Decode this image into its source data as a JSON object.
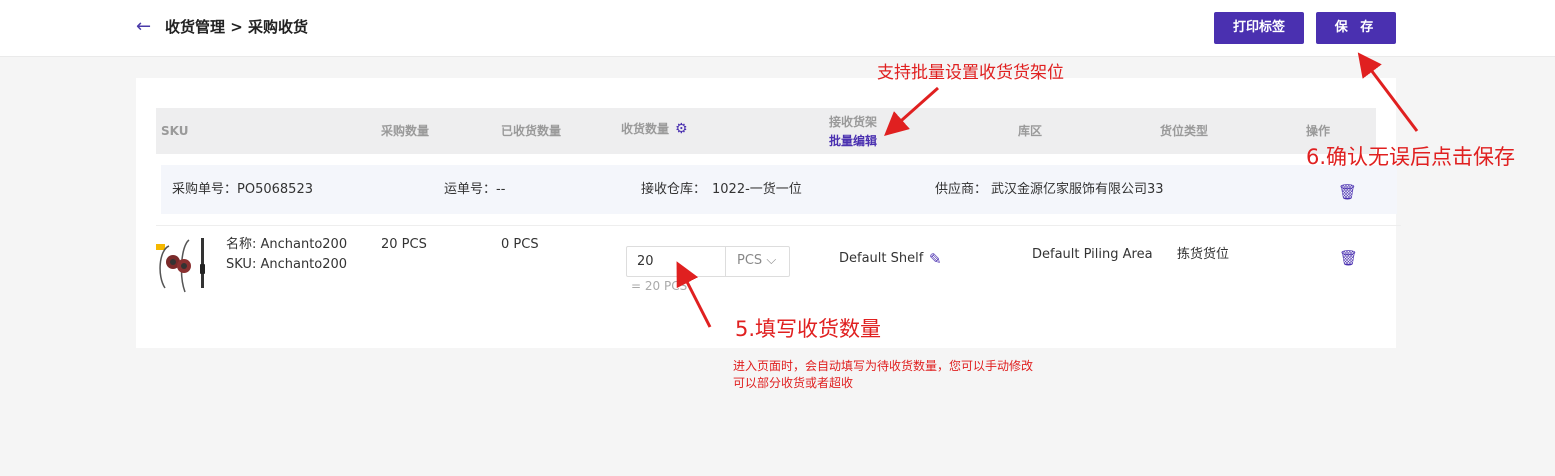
{
  "header": {
    "breadcrumb": "收货管理 > 采购收货",
    "print_label": "打印标签",
    "save_label": "保 存"
  },
  "table": {
    "columns": {
      "sku": "SKU",
      "purchase_qty": "采购数量",
      "received_qty": "已收货数量",
      "receiving_qty": "收货数量",
      "shelf": "接收货架",
      "batch_edit": "批量编辑",
      "zone": "库区",
      "slot_type": "货位类型",
      "actions": "操作"
    },
    "group": {
      "po_label": "采购单号：",
      "po_value": "PO5068523",
      "waybill_label": "运单号：",
      "waybill_value": "--",
      "warehouse_label": "接收仓库：",
      "warehouse_value": "1022-一货一位",
      "supplier_label": "供应商：",
      "supplier_value": "武汉金源亿家服饰有限公司33"
    },
    "row": {
      "name": "名称: Anchanto200",
      "sku": "SKU: Anchanto200",
      "purchase_qty": "20 PCS",
      "received_qty": "0 PCS",
      "receiving_qty": "20",
      "unit": "PCS",
      "equals": "= 20 PCS",
      "shelf": "Default Shelf",
      "zone": "Default Piling Area",
      "slot_type": "拣货货位"
    }
  },
  "annotations": {
    "batch_tip": "支持批量设置收货货架位",
    "save_tip": "6.确认无误后点击保存",
    "fill_tip": "5.填写收货数量",
    "fill_desc_1": "进入页面时，会自动填写为待收货数量，您可以手动修改",
    "fill_desc_2": "可以部分收货或者超收"
  },
  "colors": {
    "accent": "#4a30b0",
    "annotation": "#e02020"
  },
  "icons": {
    "back": "arrow-left-icon",
    "settings": "gear-icon",
    "edit": "edit-icon",
    "delete": "trash-icon"
  }
}
